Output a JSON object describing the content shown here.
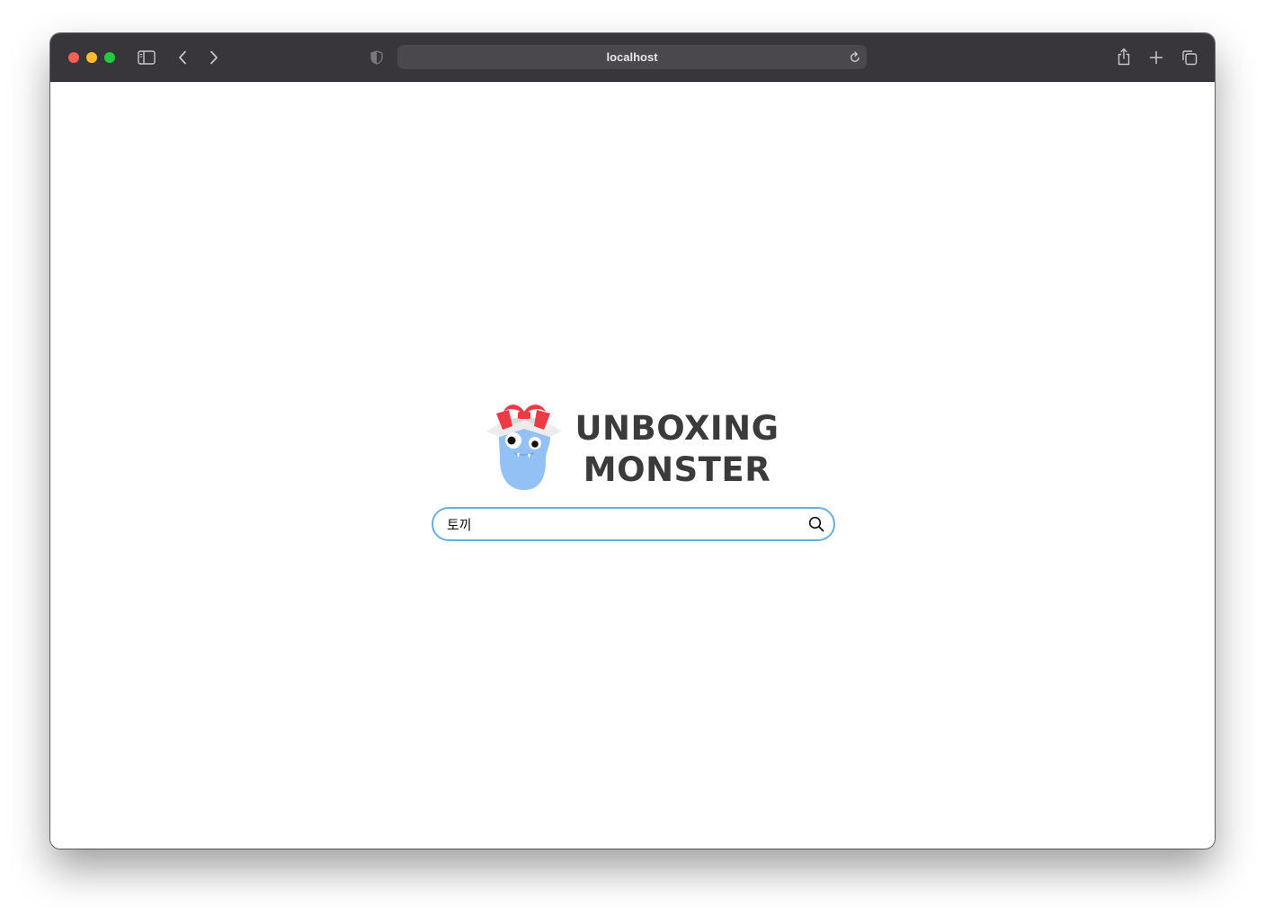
{
  "browser": {
    "url": "localhost",
    "toolbar_color": "#38363a",
    "icons": {
      "sidebar": "sidebar-icon",
      "back": "chevron-left-icon",
      "forward": "chevron-right-icon",
      "privacy": "shield-icon",
      "reload": "reload-icon",
      "share": "share-icon",
      "new_tab": "plus-icon",
      "tabs": "tabs-overview-icon"
    }
  },
  "logo": {
    "line1": "UNBOXING",
    "line2": "MONSTER",
    "text_color": "#3b3b3b",
    "mascot_color": "#93c0f5",
    "ribbon_color": "#ee3a47"
  },
  "search": {
    "value": "토끼",
    "border_color": "#6aaedf",
    "icon": "search-icon"
  }
}
